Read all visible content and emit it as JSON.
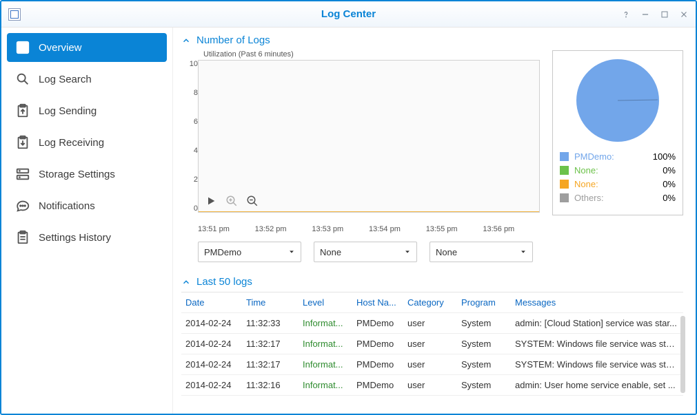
{
  "window": {
    "title": "Log Center"
  },
  "sidebar": {
    "items": [
      {
        "label": "Overview"
      },
      {
        "label": "Log Search"
      },
      {
        "label": "Log Sending"
      },
      {
        "label": "Log Receiving"
      },
      {
        "label": "Storage Settings"
      },
      {
        "label": "Notifications"
      },
      {
        "label": "Settings History"
      }
    ]
  },
  "section1": {
    "title": "Number of Logs",
    "chart_subtitle": "Utilization (Past 6 minutes)",
    "selects": [
      "PMDemo",
      "None",
      "None"
    ]
  },
  "chart_data": {
    "type": "line",
    "title": "Utilization (Past 6 minutes)",
    "ylabel": "",
    "ylim": [
      0,
      10
    ],
    "yticks": [
      0,
      2,
      4,
      6,
      8,
      10
    ],
    "categories": [
      "13:51 pm",
      "13:52 pm",
      "13:53 pm",
      "13:54 pm",
      "13:55 pm",
      "13:56 pm"
    ],
    "series": [
      {
        "name": "PMDemo",
        "values": [
          0,
          0,
          0,
          0,
          0,
          0
        ]
      }
    ]
  },
  "pie": {
    "items": [
      {
        "label": "PMDemo:",
        "value": "100%",
        "color": "#72a6ea"
      },
      {
        "label": "None:",
        "value": "0%",
        "color": "#6cc24a"
      },
      {
        "label": "None:",
        "value": "0%",
        "color": "#f5a623"
      },
      {
        "label": "Others:",
        "value": "0%",
        "color": "#9e9e9e"
      }
    ]
  },
  "section2": {
    "title": "Last 50 logs",
    "columns": [
      "Date",
      "Time",
      "Level",
      "Host Na...",
      "Category",
      "Program",
      "Messages"
    ],
    "rows": [
      {
        "date": "2014-02-24",
        "time": "11:32:33",
        "level": "Informat...",
        "host": "PMDemo",
        "cat": "user",
        "prog": "System",
        "msg": "admin: [Cloud Station] service was star..."
      },
      {
        "date": "2014-02-24",
        "time": "11:32:17",
        "level": "Informat...",
        "host": "PMDemo",
        "cat": "user",
        "prog": "System",
        "msg": "SYSTEM: Windows file service was start..."
      },
      {
        "date": "2014-02-24",
        "time": "11:32:17",
        "level": "Informat...",
        "host": "PMDemo",
        "cat": "user",
        "prog": "System",
        "msg": "SYSTEM: Windows file service was stop..."
      },
      {
        "date": "2014-02-24",
        "time": "11:32:16",
        "level": "Informat...",
        "host": "PMDemo",
        "cat": "user",
        "prog": "System",
        "msg": "admin: User home service enable, set ..."
      }
    ]
  }
}
